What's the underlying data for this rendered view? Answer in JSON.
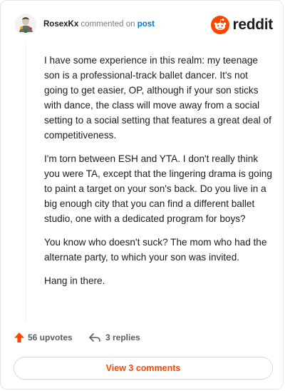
{
  "header": {
    "username": "RosexKx",
    "commented_text": "commented on",
    "post_link": "post",
    "brand": "reddit"
  },
  "comment": {
    "paragraphs": [
      "I have some experience in this realm: my teenage son is a professional-track ballet dancer. It's not going to get easier, OP, although if your son sticks with dance, the class will move away from a social setting to a social setting that features a great deal of competitiveness.",
      "I'm torn between ESH and YTA. I don't really think you were TA, except that the lingering drama is going to paint a target on your son's back. Do you live in a big enough city that you can find a different ballet studio, one with a dedicated program for boys?",
      "You know who doesn't suck? The mom who had the alternate party, to which your son was invited.",
      "Hang in there."
    ]
  },
  "actions": {
    "upvotes": "56 upvotes",
    "replies": "3 replies",
    "upvote_icon": "upvote-arrow-icon",
    "reply_icon": "reply-arrow-icon"
  },
  "footer": {
    "view_comments": "View 3 comments"
  },
  "colors": {
    "accent": "#ff4500",
    "link": "#0079d3",
    "muted": "#7c7c7c"
  }
}
